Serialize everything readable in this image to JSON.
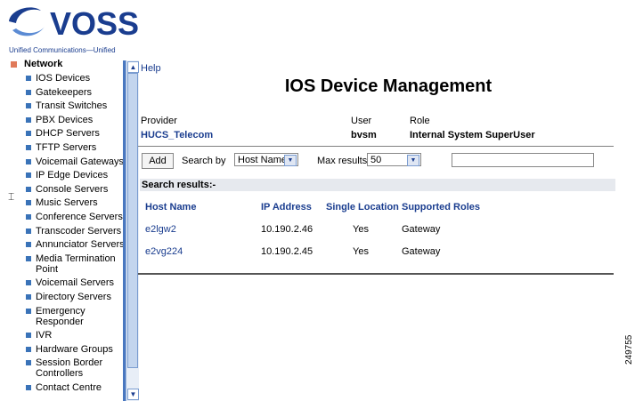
{
  "logo": {
    "brand": "VOSS",
    "tagline": "Unified Communications—Unified"
  },
  "nav": {
    "section": "Network",
    "items": [
      "IOS Devices",
      "Gatekeepers",
      "Transit Switches",
      "PBX Devices",
      "DHCP Servers",
      "TFTP Servers",
      "Voicemail Gateways",
      "IP Edge Devices",
      "Console Servers",
      "Music Servers",
      "Conference Servers",
      "Transcoder Servers",
      "Annunciator Servers",
      "Media Termination Point",
      "Voicemail Servers",
      "Directory Servers",
      "Emergency Responder",
      "IVR",
      "Hardware Groups",
      "Session Border Controllers",
      "Contact Centre"
    ]
  },
  "help": "Help",
  "title": "IOS Device Management",
  "context": {
    "provider_label": "Provider",
    "provider": "HUCS_Telecom",
    "user_label": "User",
    "user": "bvsm",
    "role_label": "Role",
    "role": "Internal System SuperUser"
  },
  "search": {
    "add": "Add",
    "search_by_label": "Search by",
    "search_by": "Host Name",
    "max_results_label": "Max results",
    "max_results": "50",
    "query": ""
  },
  "results": {
    "label": "Search results:-",
    "columns": [
      "Host Name",
      "IP Address",
      "Single Location",
      "Supported Roles"
    ],
    "rows": [
      {
        "host": "e2lgw2",
        "ip": "10.190.2.46",
        "single": "Yes",
        "roles": "Gateway"
      },
      {
        "host": "e2vg224",
        "ip": "10.190.2.45",
        "single": "Yes",
        "roles": "Gateway"
      }
    ]
  },
  "figure_id": "249755"
}
